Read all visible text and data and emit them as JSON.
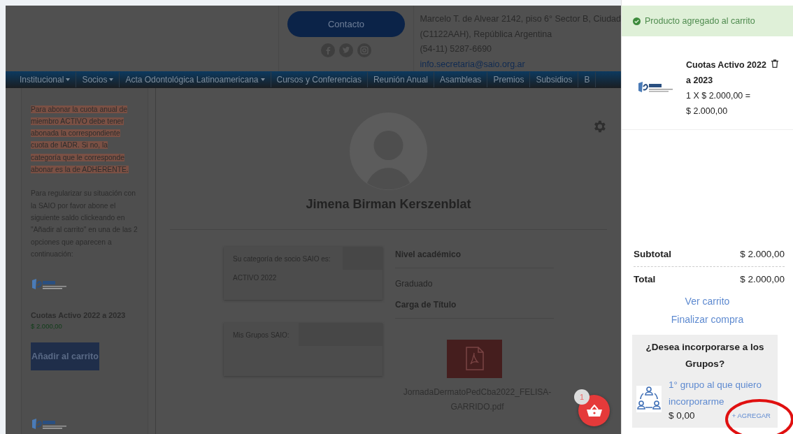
{
  "header": {
    "contact_button": "Contacto",
    "address_lines": [
      "Marcelo T. de Alvear 2142, piso 6° Sector B, Ciudad",
      "(C1122AAH), República Argentina",
      "(54-11) 5287-6690"
    ],
    "email": "info.secretaria@saio.org.ar"
  },
  "nav": [
    {
      "label": "Institucional",
      "has_submenu": true
    },
    {
      "label": "Socios",
      "has_submenu": true
    },
    {
      "label": "Acta Odontológica Latinoamericana",
      "has_submenu": true
    },
    {
      "label": "Cursos y Conferencias",
      "has_submenu": false
    },
    {
      "label": "Reunión Anual",
      "has_submenu": false
    },
    {
      "label": "Asambleas",
      "has_submenu": false
    },
    {
      "label": "Premios",
      "has_submenu": false
    },
    {
      "label": "Subsidios",
      "has_submenu": false
    },
    {
      "label": "B",
      "has_submenu": false
    }
  ],
  "sidebar": {
    "notice": " Para abonar la cuota anual de miembro ACTIVO debe tener abonada la correspondiente cuota de IADR. Si no, la categoría que le corresponde abonar es la de ADHERENTE.",
    "paragraph": "Para regularizar su situación con la SAIO por favor abone el siguiente saldo clickeando en \"Añadir al carrito\" en una de las 2 opciones que aparecen a continuación:",
    "products": [
      {
        "name": "Cuotas Activo 2022 a 2023",
        "price": "$ 2.000,00",
        "button": "Añadir al carrito"
      }
    ]
  },
  "profile": {
    "name": "Jimena Birman Kerszenblat",
    "category_label": "Su categoría de socio SAIO es:",
    "category": "ACTIVO 2022",
    "groups_label": "Mis Grupos SAIO:",
    "fields": [
      {
        "label": "Nivel académico",
        "value": "Graduado"
      },
      {
        "label": "Carga de Título",
        "file": "JornadaDermatoPedCba2022_FELISA-GARRIDO.pdf"
      }
    ]
  },
  "cart_fab": {
    "count": "1"
  },
  "cart": {
    "notice": "Producto agregado al carrito",
    "items": [
      {
        "name": "Cuotas Activo 2022 a 2023",
        "quantity": "1 X $ 2.000,00 =",
        "total": "$ 2.000,00"
      }
    ],
    "subtotal_label": "Subtotal",
    "subtotal": "$ 2.000,00",
    "total_label": "Total",
    "total": "$ 2.000,00",
    "links": [
      "Ver carrito",
      "Finalizar compra"
    ],
    "upsell": {
      "title": "¿Desea incorporarse a los Grupos?",
      "products": [
        {
          "name": "1° grupo al que quiero incorporarme",
          "price": "$ 0,00",
          "button": "+ AGREGAR",
          "highlighted": true
        }
      ]
    }
  }
}
